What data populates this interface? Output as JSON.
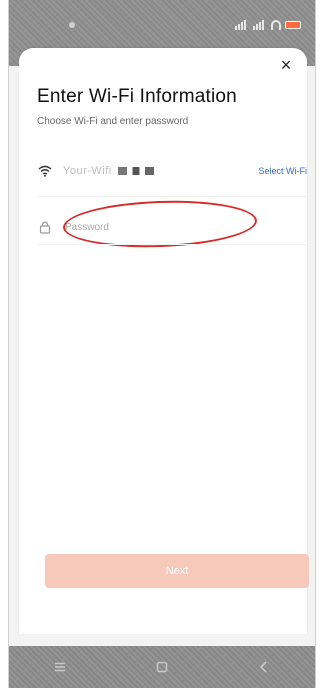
{
  "header": {
    "close_glyph": "×",
    "title": "Enter Wi-Fi Information",
    "subtitle": "Choose Wi-Fi and enter password"
  },
  "wifi": {
    "ssid": "Your-Wifi",
    "select_label": "Select Wi-Fi",
    "icon": "wifi-icon"
  },
  "password": {
    "placeholder": "Password",
    "value": "",
    "icon": "lock-icon"
  },
  "footer": {
    "next_label": "Next",
    "next_color": "#f7c9bb"
  },
  "navigation": {
    "menu_icon": "menu-icon",
    "home_icon": "home-square-icon",
    "back_icon": "back-chevron-icon"
  },
  "colors": {
    "accent": "#ff6b3d",
    "link": "#2f6bd7",
    "annotation": "#d62b2b"
  }
}
